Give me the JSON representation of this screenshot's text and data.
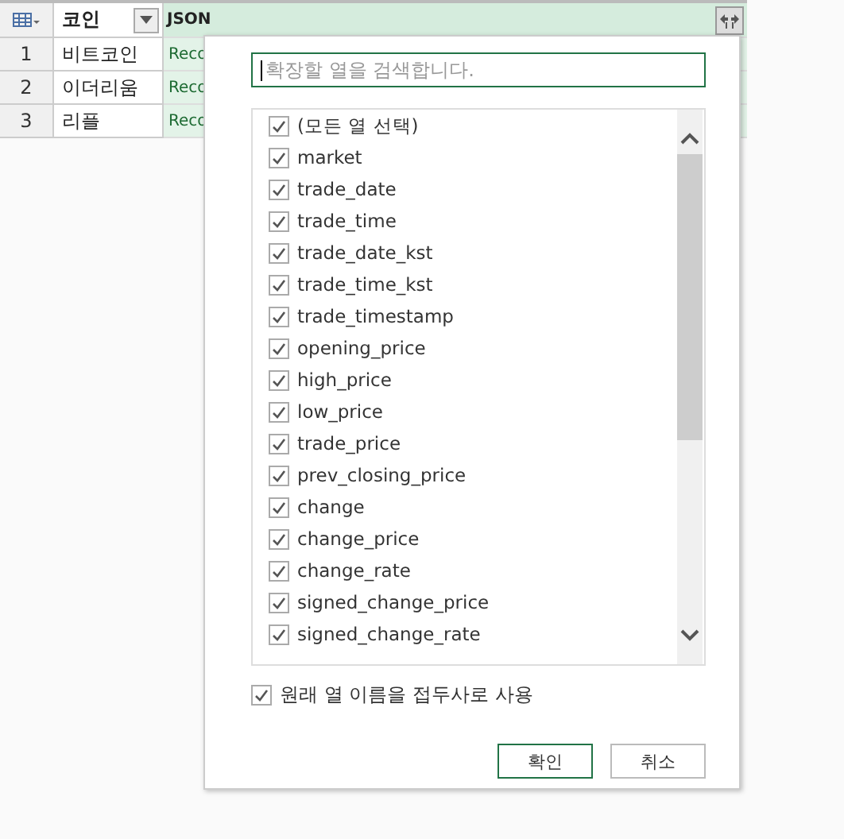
{
  "table": {
    "columns": [
      {
        "label": "코인"
      },
      {
        "label": "JSON"
      }
    ],
    "rows": [
      {
        "number": "1",
        "coin": "비트코인",
        "json": "Reco"
      },
      {
        "number": "2",
        "coin": "이더리움",
        "json": "Reco"
      },
      {
        "number": "3",
        "coin": "리플",
        "json": "Reco"
      }
    ]
  },
  "expand_popup": {
    "search": {
      "placeholder": "확장할 열을 검색합니다."
    },
    "columns": [
      {
        "label": "(모든 열 선택)",
        "checked": true
      },
      {
        "label": "market",
        "checked": true
      },
      {
        "label": "trade_date",
        "checked": true
      },
      {
        "label": "trade_time",
        "checked": true
      },
      {
        "label": "trade_date_kst",
        "checked": true
      },
      {
        "label": "trade_time_kst",
        "checked": true
      },
      {
        "label": "trade_timestamp",
        "checked": true
      },
      {
        "label": "opening_price",
        "checked": true
      },
      {
        "label": "high_price",
        "checked": true
      },
      {
        "label": "low_price",
        "checked": true
      },
      {
        "label": "trade_price",
        "checked": true
      },
      {
        "label": "prev_closing_price",
        "checked": true
      },
      {
        "label": "change",
        "checked": true
      },
      {
        "label": "change_price",
        "checked": true
      },
      {
        "label": "change_rate",
        "checked": true
      },
      {
        "label": "signed_change_price",
        "checked": true
      },
      {
        "label": "signed_change_rate",
        "checked": true
      }
    ],
    "prefix_option": {
      "label": "원래 열 이름을 접두사로 사용",
      "checked": true
    },
    "buttons": [
      {
        "label": "확인",
        "primary": true
      },
      {
        "label": "취소",
        "primary": false
      }
    ]
  }
}
